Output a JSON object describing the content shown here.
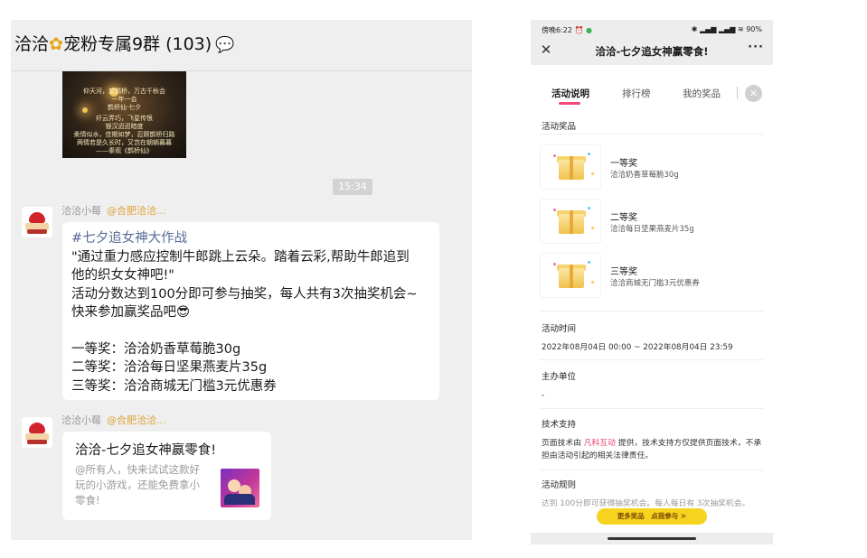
{
  "chat": {
    "group_title_prefix": "洽洽",
    "group_title_name": "宠粉专属9群",
    "group_member_count": "(103)",
    "image_caption_lines": [
      "仰天河，望鹊桥，万古千秋会",
      "一年一会",
      "鹊桥仙·七夕",
      "纤云弄巧，飞星传恨",
      "银汉迢迢暗度",
      "柔情似水，佳期如梦，忍顾鹊桥归路",
      "两情若是久长时，又岂在朝朝暮暮",
      "——秦观《鹊桥仙》"
    ],
    "timestamp": "15:34",
    "messages": [
      {
        "sender": "洽洽小莓",
        "mention": "@合肥洽洽...",
        "hashtag": "#七夕追女神大作战",
        "lines": [
          "\"通过重力感应控制牛郎跳上云朵。踏着云彩,帮助牛郎追到",
          "他的织女女神吧!\"",
          "活动分数达到100分即可参与抽奖，每人共有3次抽奖机会~",
          "快来参加赢奖品吧😎",
          "",
          "一等奖：洽洽奶香草莓脆30g",
          "二等奖：洽洽每日坚果燕麦片35g",
          "三等奖：洽洽商城无门槛3元优惠券"
        ]
      },
      {
        "sender": "洽洽小莓",
        "mention": "@合肥洽洽...",
        "card_title": "洽洽-七夕追女神赢零食!",
        "card_desc": "@所有人，快来试试这款好玩的小游戏，还能免费拿小零食!"
      }
    ]
  },
  "phone": {
    "status_time": "傍晚6:22",
    "status_right": "✱ ▂▄▆ ▂▄▆ ≋ 90%",
    "nav_title": "洽洽-七夕追女神赢零食!",
    "tabs": {
      "desc": "活动说明",
      "rank": "排行榜",
      "mine": "我的奖品"
    },
    "sections": {
      "prizes_title": "活动奖品",
      "time_title": "活动时间",
      "time_value": "2022年08月04日 00:00 ~ 2022年08月04日 23:59",
      "sponsor_title": "主办单位",
      "sponsor_value": "-",
      "tech_title": "技术支持",
      "tech_pre": "页面技术由 ",
      "tech_link": "凡科互动",
      "tech_post": " 提供，技术支持方仅提供页面技术，不承担由活动引起的相关法律责任。",
      "rules_title": "活动规则",
      "rules_value": "达到 100分即可获得抽奖机会。每人每日有 3次抽奖机会。"
    },
    "prizes": [
      {
        "name": "一等奖",
        "desc": "洽洽奶香草莓脆30g"
      },
      {
        "name": "二等奖",
        "desc": "洽洽每日坚果燕麦片35g"
      },
      {
        "name": "三等奖",
        "desc": "洽洽商城无门槛3元优惠券"
      }
    ],
    "bottom_button": "更多奖品　点我参与 >"
  },
  "colors": {
    "accent_pink": "#ef4a7a",
    "link_pink": "#e8456f",
    "button_yellow": "#f5d31f",
    "hashtag_blue": "#576b95",
    "mention_orange": "#e0a23a"
  },
  "icons": [
    "sunflower-icon",
    "chat-bubble-icon",
    "close-icon",
    "more-icon",
    "gift-box-icon",
    "wechat-icon",
    "battery-icon"
  ]
}
